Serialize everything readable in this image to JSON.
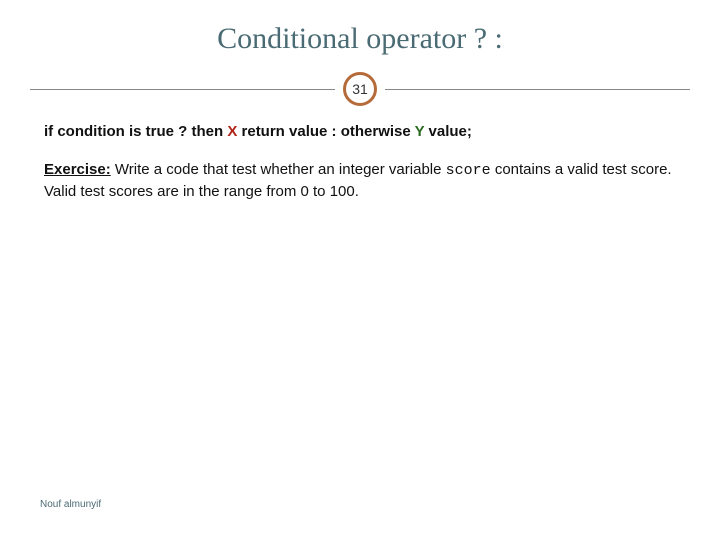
{
  "slide": {
    "title": "Conditional operator  ? :",
    "page_number": "31",
    "syntax": {
      "s1": "if condition is true ? then ",
      "x": "X",
      "s2": " return value : otherwise ",
      "y": "Y",
      "s3": " value;"
    },
    "exercise": {
      "label": "Exercise:",
      "part1": " Write a code that test whether an integer variable ",
      "code": "score",
      "part2": " contains a valid test score. Valid test scores are in the range from 0 to 100."
    },
    "footer": "Nouf almunyif"
  }
}
